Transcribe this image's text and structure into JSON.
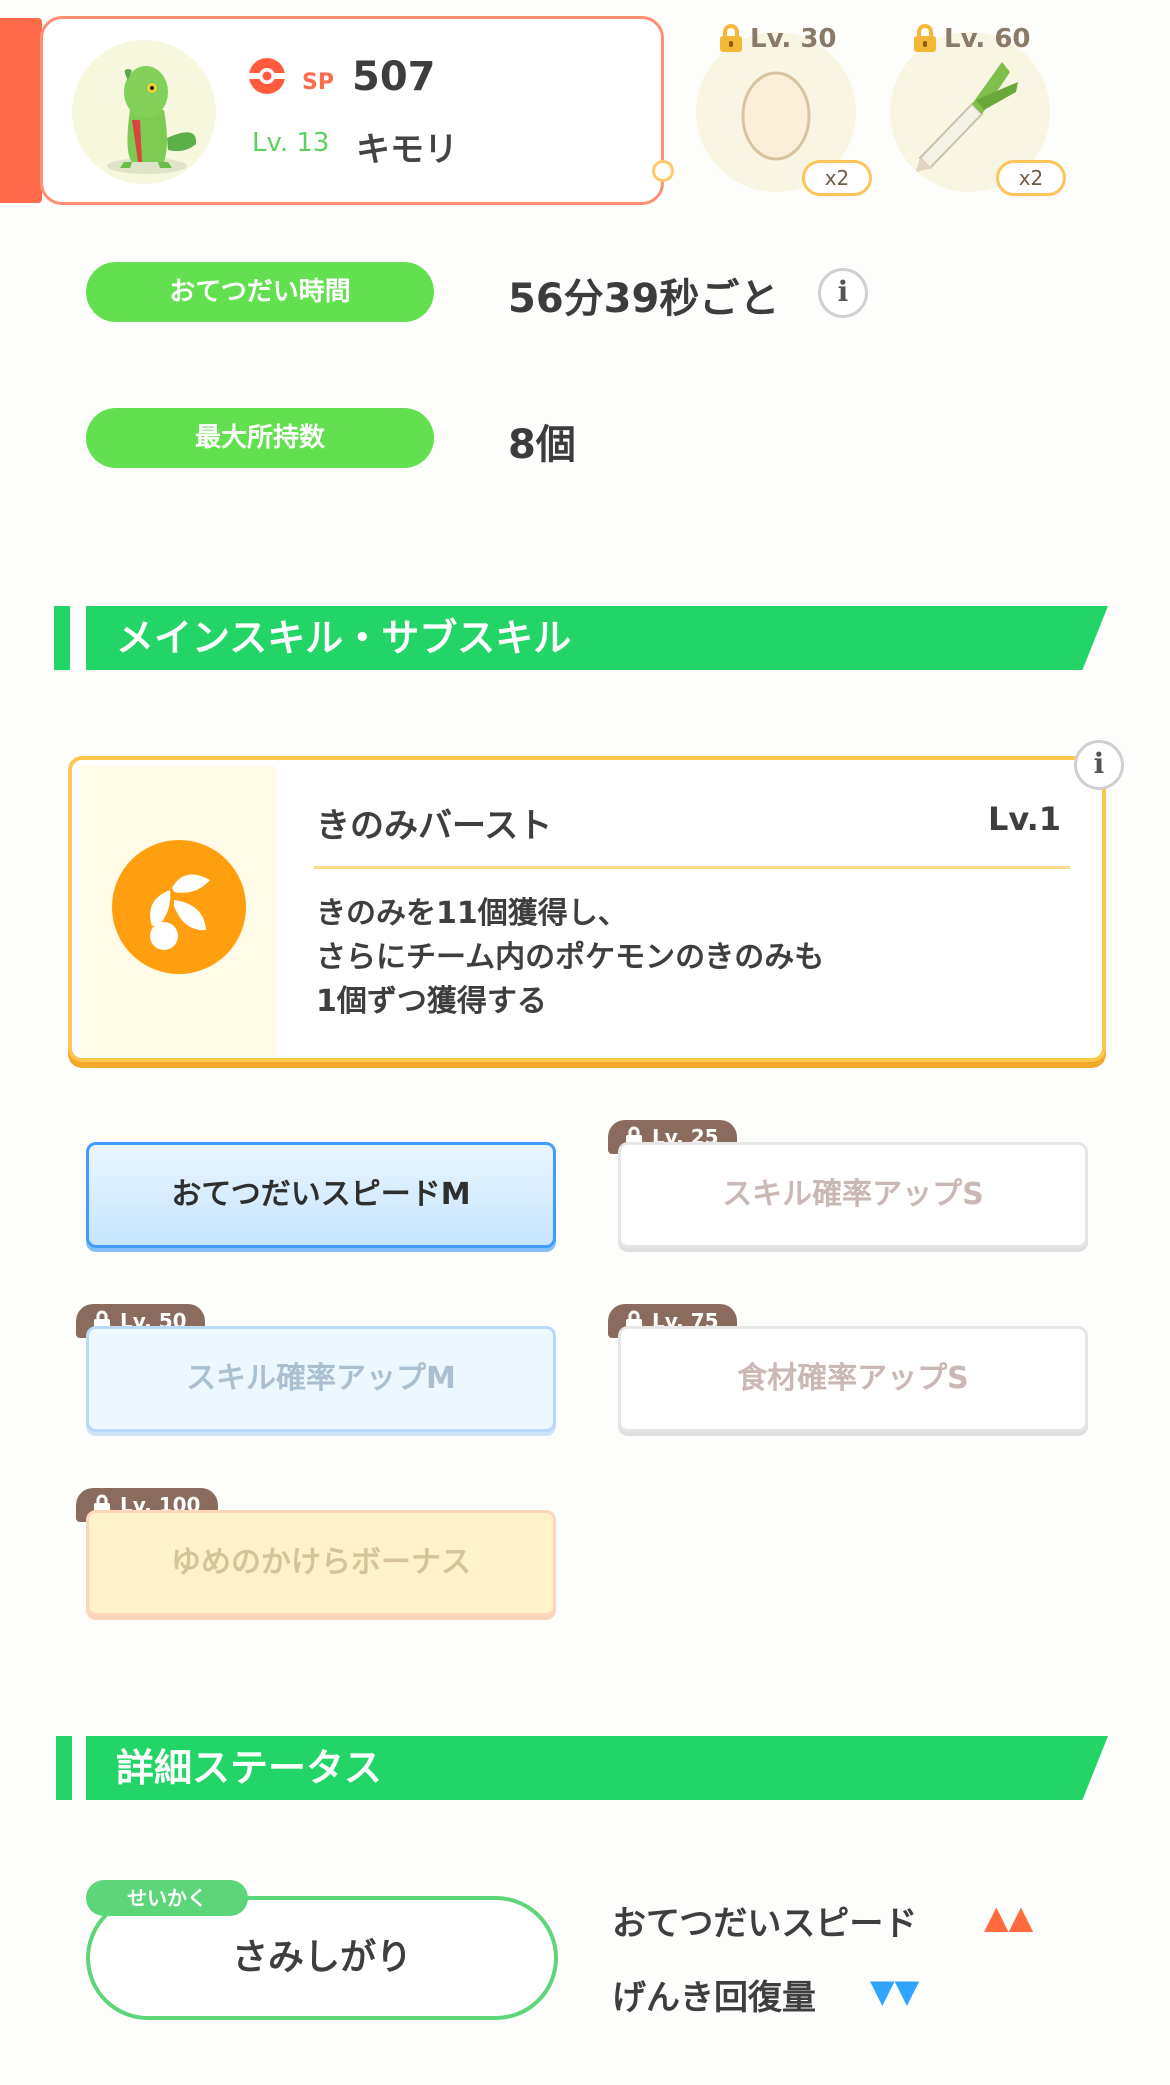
{
  "pokemon": {
    "sp_label": "SP",
    "sp_value": "507",
    "level": "Lv. 13",
    "name": "キモリ"
  },
  "ingredients": [
    {
      "lock_level": "Lv. 30",
      "icon": "egg-icon",
      "count": "x2"
    },
    {
      "lock_level": "Lv. 60",
      "icon": "leek-icon",
      "count": "x2"
    }
  ],
  "stats": [
    {
      "label": "おてつだい時間",
      "value": "56分39秒ごと"
    },
    {
      "label": "最大所持数",
      "value": "8個"
    }
  ],
  "sections": {
    "skills_title": "メインスキル・サブスキル",
    "status_title": "詳細ステータス"
  },
  "main_skill": {
    "name": "きのみバースト",
    "level": "Lv.1",
    "description": [
      "きのみを11個獲得し、",
      "さらにチーム内のポケモンのきのみも",
      "1個ずつ獲得する"
    ]
  },
  "sub_skills": [
    {
      "label": "おてつだいスピードM",
      "lock": ""
    },
    {
      "label": "スキル確率アップS",
      "lock": "Lv. 25"
    },
    {
      "label": "スキル確率アップM",
      "lock": "Lv. 50"
    },
    {
      "label": "食材確率アップS",
      "lock": "Lv. 75"
    },
    {
      "label": "ゆめのかけらボーナス",
      "lock": "Lv. 100"
    }
  ],
  "nature": {
    "tag": "せいかく",
    "name": "さみしがり",
    "effects": [
      {
        "label": "おてつだいスピード",
        "symbol": "▲▲",
        "color": "#ff6b3d"
      },
      {
        "label": "げんき回復量",
        "symbol": "▼▼",
        "color": "#2fa4ff"
      }
    ]
  },
  "colors": {
    "accent": "#ff6b4a",
    "green": "#23d567",
    "pill_green": "#63e04f",
    "skill_orange": "#ff9f0f"
  }
}
